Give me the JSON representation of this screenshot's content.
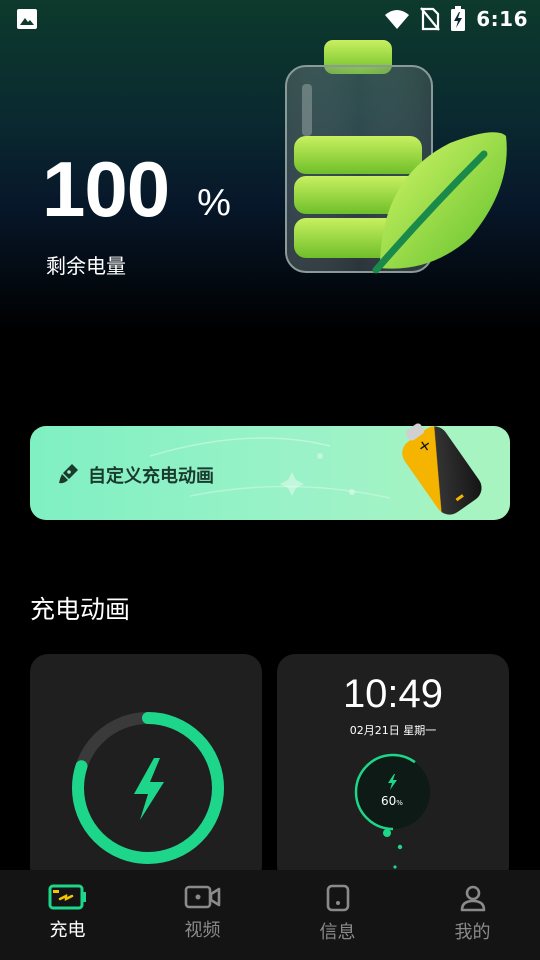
{
  "status_bar": {
    "time": "6:16",
    "icons": [
      "gallery-icon",
      "wifi-icon",
      "no-sim-icon",
      "battery-charging-icon"
    ]
  },
  "battery": {
    "value": "100",
    "unit": "%",
    "label": "剩余电量"
  },
  "banner": {
    "label": "自定义充电动画",
    "icon": "paint-brush-icon"
  },
  "section": {
    "title": "充电动画"
  },
  "preview_clock": {
    "time": "10:49",
    "date": "02月21日 星期一",
    "percent": "60",
    "percent_suffix": "%",
    "ring_level": 0.6
  },
  "preview_ring": {
    "ring_level": 0.8
  },
  "nav": [
    {
      "label": "充电",
      "icon": "charging-icon",
      "active": true
    },
    {
      "label": "视频",
      "icon": "video-icon",
      "active": false
    },
    {
      "label": "信息",
      "icon": "phone-info-icon",
      "active": false
    },
    {
      "label": "我的",
      "icon": "profile-icon",
      "active": false
    }
  ],
  "colors": {
    "accent": "#1ed68a",
    "banner_start": "#7ff0c2",
    "banner_end": "#a9f4c0",
    "nav_background": "#141414",
    "card_background": "#1f1f1f"
  }
}
